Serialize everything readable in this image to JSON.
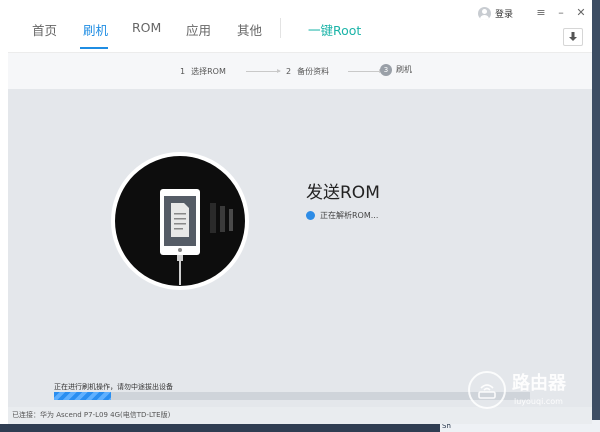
{
  "nav": {
    "items": [
      {
        "label": "首页"
      },
      {
        "label": "刷机"
      },
      {
        "label": "ROM"
      },
      {
        "label": "应用"
      },
      {
        "label": "其他"
      }
    ],
    "root_label": "一键Root",
    "login_label": "登录"
  },
  "steps": [
    {
      "num": "1",
      "label": "选择ROM"
    },
    {
      "num": "2",
      "label": "备份资料"
    },
    {
      "num": "3",
      "label": "刷机"
    }
  ],
  "main": {
    "title": "发送ROM",
    "status": "正在解析ROM..."
  },
  "progress": {
    "label": "正在进行刷机操作，请勿中途拔出设备",
    "value_percent": 12
  },
  "footer": {
    "device": "已连接：华为 Ascend P7-L09 4G(电信TD-LTE版)"
  },
  "watermark": {
    "title": "路由器",
    "url": "luyouqi.com"
  },
  "background": {
    "strip_text": "Sh"
  },
  "colors": {
    "accent": "#1f8de3",
    "root": "#1bb4a8",
    "content_bg": "#e4e7eb"
  }
}
